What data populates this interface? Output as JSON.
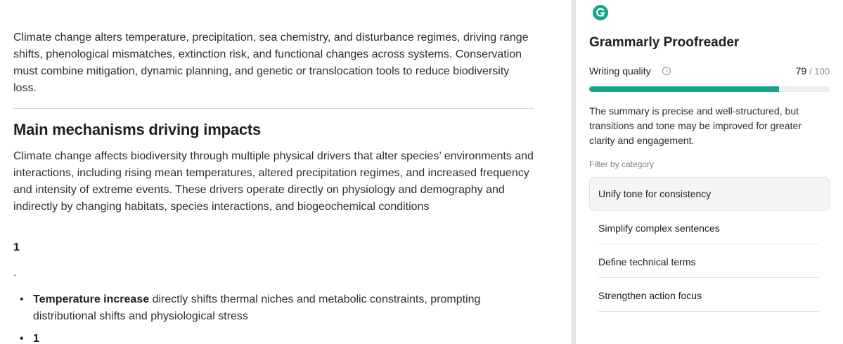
{
  "document": {
    "intro": "Climate change alters temperature, precipitation, sea chemistry, and disturbance regimes, driving range shifts, phenological mismatches, extinction risk, and functional changes across systems. Conservation must combine mitigation, dynamic planning, and genetic or translocation tools to reduce biodiversity loss.",
    "heading": "Main mechanisms driving impacts",
    "body": "Climate change affects biodiversity through multiple physical drivers that alter species’ environments and interactions, including rising mean temperatures, altered precipitation regimes, and increased frequency and intensity of extreme events. These drivers operate directly on physiology and demography and indirectly by changing habitats, species interactions, and biogeochemical conditions",
    "ref_number": "1",
    "period": ".",
    "bullets": [
      {
        "bold": "Temperature increase",
        "text": " directly shifts thermal niches and metabolic constraints, prompting distributional shifts and physiological stress"
      },
      {
        "bold": "1",
        "text": ""
      }
    ]
  },
  "panel": {
    "logo_icon": "grammarly-logo-icon",
    "title": "Grammarly Proofreader",
    "writing_quality_label": "Writing quality",
    "score": "79",
    "score_max": "/ 100",
    "score_fraction": 0.79,
    "summary": "The summary is precise and well-structured, but transitions and tone may be improved for greater clarity and engagement.",
    "filter_label": "Filter by category",
    "active_category": "Unify tone for consistency",
    "categories": [
      "Simplify complex sentences",
      "Define technical terms",
      "Strengthen action focus"
    ]
  },
  "colors": {
    "accent": "#15a38c",
    "text": "#1c1f23",
    "muted": "#7b8087"
  }
}
